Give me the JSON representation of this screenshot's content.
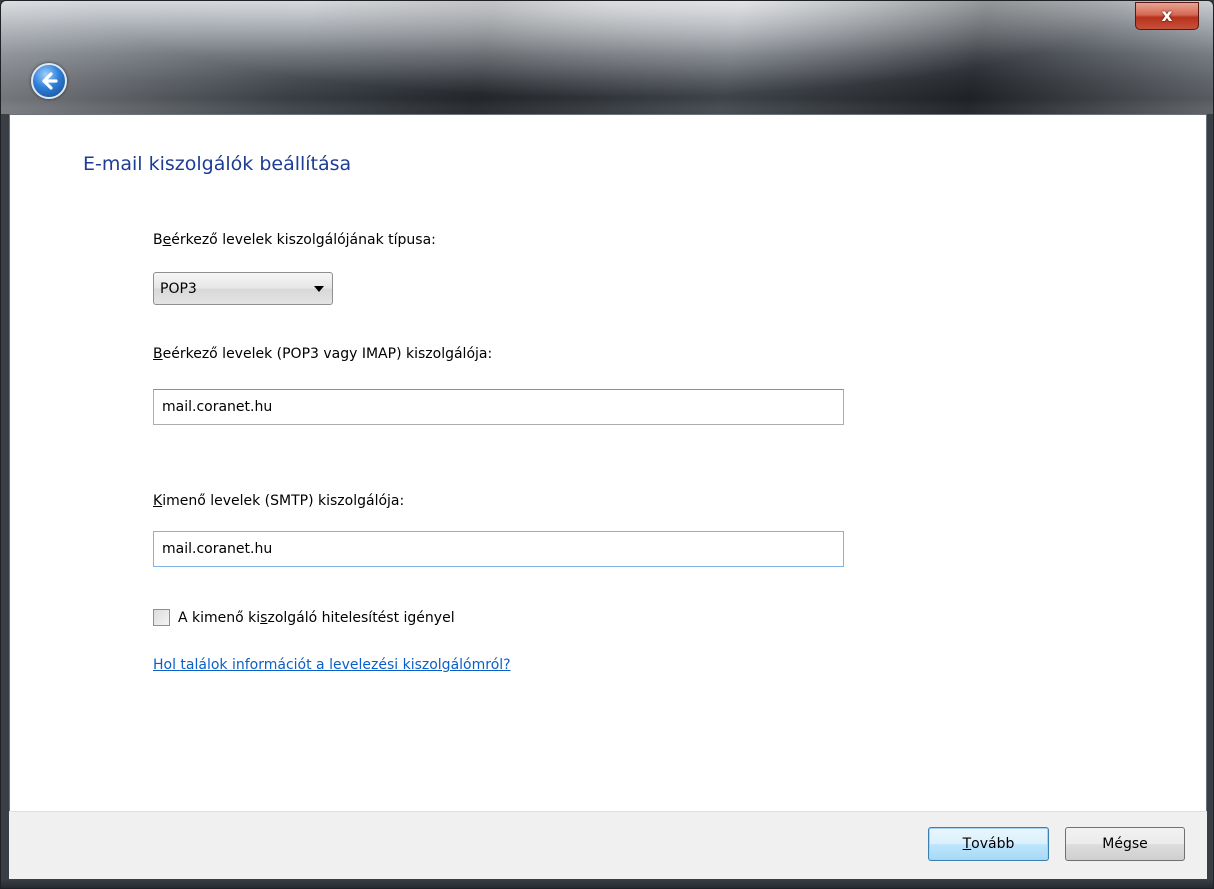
{
  "window": {
    "close_label": "x"
  },
  "page": {
    "title": "E-mail kiszolgálók beállítása"
  },
  "form": {
    "incoming_type_label_prefix": "B",
    "incoming_type_label_accel": "e",
    "incoming_type_label_rest": "érkező levelek kiszolgálójának típusa:",
    "incoming_type_value": "POP3",
    "incoming_server_label_accel": "B",
    "incoming_server_label_rest": "eérkező levelek (POP3 vagy IMAP) kiszolgálója:",
    "incoming_server_value": "mail.coranet.hu",
    "outgoing_server_label_accel": "K",
    "outgoing_server_label_rest": "imenő levelek (SMTP) kiszolgálója:",
    "outgoing_server_value": "mail.coranet.hu",
    "auth_checkbox_prefix": "A kimenő ki",
    "auth_checkbox_accel": "s",
    "auth_checkbox_rest": "zolgáló hitelesítést igényel",
    "auth_checked": false,
    "help_link": "Hol találok információt a levelezési kiszolgálómról?"
  },
  "footer": {
    "next_accel": "T",
    "next_rest": "ovább",
    "cancel_label": "Mégse"
  }
}
